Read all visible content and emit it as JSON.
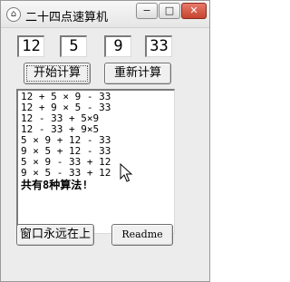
{
  "window": {
    "title": "二十四点速算机",
    "app_icon": "calculator-icon",
    "controls": {
      "minimize": "−",
      "maximize": "□",
      "close": "✕"
    }
  },
  "numbers": [
    "12",
    "5",
    "9",
    "33"
  ],
  "buttons": {
    "start": "开始计算",
    "reset": "重新计算",
    "topmost": "窗口永远在上",
    "readme": "Readme"
  },
  "results": {
    "lines": [
      "12 + 5 × 9 - 33",
      "12 + 9 × 5 - 33",
      "12 - 33 + 5×9",
      "12 - 33 + 9×5",
      "5 × 9 + 12 - 33",
      "9 × 5 + 12 - 33",
      "5 × 9 - 33 + 12",
      "9 × 5 - 33 + 12"
    ],
    "summary": "共有8种算法!"
  },
  "colors": {
    "window_bg": "#ececec",
    "field_bg": "#ffffff",
    "close_button": "#c5452e"
  }
}
